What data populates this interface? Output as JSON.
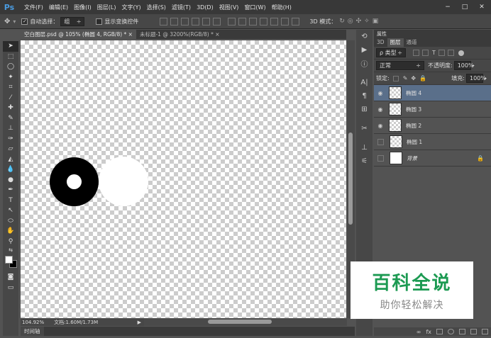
{
  "app": {
    "logo": "Ps"
  },
  "menubar": {
    "items": [
      "文件(F)",
      "编辑(E)",
      "图像(I)",
      "图层(L)",
      "文字(Y)",
      "选择(S)",
      "滤镜(T)",
      "3D(D)",
      "视图(V)",
      "窗口(W)",
      "帮助(H)"
    ],
    "minimize": "−",
    "maximize": "□",
    "close": "✕"
  },
  "options": {
    "auto_select_label": "自动选择：",
    "auto_select_value": "组",
    "show_transform_label": "显示变换控件",
    "mode_3d_label": "3D 模式："
  },
  "tabs": [
    {
      "label": "空白图层.psd @ 105% (椭圆 4, RGB/8) * ×"
    },
    {
      "label": "未标题-1 @ 3200%(RGB/8) * ×"
    }
  ],
  "status": {
    "zoom": "104.92%",
    "doc_info": "文档:1.60M/1.73M"
  },
  "timeline": {
    "label": "时间轴"
  },
  "panel": {
    "header": "属性",
    "tabs": [
      "3D",
      "图层",
      "通道"
    ],
    "filter_kind": "ρ 类型",
    "blend_mode": "正常",
    "opacity_label": "不透明度:",
    "opacity_value": "100%",
    "lock_label": "锁定:",
    "fill_label": "填充:",
    "fill_value": "100%",
    "layers": [
      {
        "name": "椭圆 4",
        "visible": true,
        "active": true
      },
      {
        "name": "椭圆 3",
        "visible": true,
        "active": false
      },
      {
        "name": "椭圆 2",
        "visible": true,
        "active": false
      },
      {
        "name": "椭圆 1",
        "visible": false,
        "active": false
      },
      {
        "name": "背景",
        "visible": false,
        "active": false,
        "locked": true
      }
    ]
  },
  "watermark": {
    "title": "百科全说",
    "subtitle": "助你轻松解决"
  },
  "colors": {
    "accent_layer": "#5a6f8a",
    "watermark_green": "#1c9a52"
  }
}
